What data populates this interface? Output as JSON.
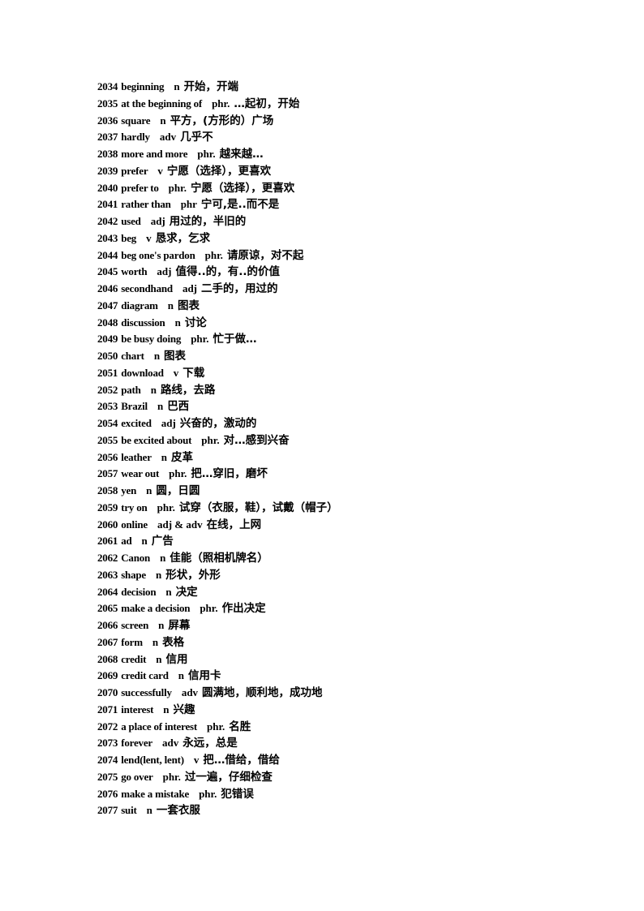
{
  "document": {
    "entries": [
      {
        "num": "2034",
        "word": "beginning",
        "pos": "n",
        "meaning": "开始，开端"
      },
      {
        "num": "2035",
        "word": "at the beginning of",
        "pos": "phr.",
        "meaning": "…起初，开始"
      },
      {
        "num": "2036",
        "word": "square",
        "pos": "n",
        "meaning": "平方，(方形的）广场"
      },
      {
        "num": "2037",
        "word": "hardly",
        "pos": "adv",
        "meaning": "几乎不"
      },
      {
        "num": "2038",
        "word": "more and more",
        "pos": "phr.",
        "meaning": "越来越…"
      },
      {
        "num": "2039",
        "word": "prefer",
        "pos": "v",
        "meaning": "宁愿（选择），更喜欢"
      },
      {
        "num": "2040",
        "word": "prefer to",
        "pos": "phr.",
        "meaning": "宁愿（选择），更喜欢"
      },
      {
        "num": "2041",
        "word": "rather than",
        "pos": "phr",
        "meaning": "宁可,是..而不是"
      },
      {
        "num": "2042",
        "word": "used",
        "pos": "adj",
        "meaning": "用过的，半旧的"
      },
      {
        "num": "2043",
        "word": "beg",
        "pos": "v",
        "meaning": "恳求，乞求"
      },
      {
        "num": "2044",
        "word": "beg one's pardon",
        "pos": "phr.",
        "meaning": "请原谅，对不起"
      },
      {
        "num": "2045",
        "word": "worth",
        "pos": "adj",
        "meaning": "值得..的，有..的价值"
      },
      {
        "num": "2046",
        "word": "secondhand",
        "pos": "adj",
        "meaning": "二手的，用过的"
      },
      {
        "num": "2047",
        "word": "diagram",
        "pos": "n",
        "meaning": "图表"
      },
      {
        "num": "2048",
        "word": "discussion",
        "pos": "n",
        "meaning": "讨论"
      },
      {
        "num": "2049",
        "word": "be busy doing",
        "pos": "phr.",
        "meaning": "忙于做…"
      },
      {
        "num": "2050",
        "word": "chart",
        "pos": "n",
        "meaning": "图表"
      },
      {
        "num": "2051",
        "word": "download",
        "pos": "v",
        "meaning": "下载"
      },
      {
        "num": "2052",
        "word": "path",
        "pos": "n",
        "meaning": "路线，去路"
      },
      {
        "num": "2053",
        "word": "Brazil",
        "pos": "n",
        "meaning": "巴西"
      },
      {
        "num": "2054",
        "word": "excited",
        "pos": "adj",
        "meaning": "兴奋的，激动的"
      },
      {
        "num": "2055",
        "word": "be excited about",
        "pos": "phr.",
        "meaning": "对…感到兴奋"
      },
      {
        "num": "2056",
        "word": "leather",
        "pos": "n",
        "meaning": "皮革"
      },
      {
        "num": "2057",
        "word": "wear out",
        "pos": "phr.",
        "meaning": "把…穿旧，磨坏"
      },
      {
        "num": "2058",
        "word": "yen",
        "pos": "n",
        "meaning": "圆，日圆"
      },
      {
        "num": "2059",
        "word": "try on",
        "pos": "phr.",
        "meaning": "试穿（衣服，鞋），试戴（帽子）"
      },
      {
        "num": "2060",
        "word": "online",
        "pos": "adj & adv",
        "meaning": "在线，上网"
      },
      {
        "num": "2061",
        "word": "ad",
        "pos": "n",
        "meaning": "广告"
      },
      {
        "num": "2062",
        "word": "Canon",
        "pos": "n",
        "meaning": "佳能（照相机牌名）"
      },
      {
        "num": "2063",
        "word": "shape",
        "pos": "n",
        "meaning": "形状，外形"
      },
      {
        "num": "2064",
        "word": "decision",
        "pos": "n",
        "meaning": "决定"
      },
      {
        "num": "2065",
        "word": "make a decision",
        "pos": "phr.",
        "meaning": "作出决定"
      },
      {
        "num": "2066",
        "word": "screen",
        "pos": "n",
        "meaning": "屏幕"
      },
      {
        "num": "2067",
        "word": "form",
        "pos": "n",
        "meaning": "表格"
      },
      {
        "num": "2068",
        "word": "credit",
        "pos": "n",
        "meaning": "信用"
      },
      {
        "num": "2069",
        "word": "credit card",
        "pos": "n",
        "meaning": "信用卡"
      },
      {
        "num": "2070",
        "word": "successfully",
        "pos": "adv",
        "meaning": "圆满地，顺利地，成功地"
      },
      {
        "num": "2071",
        "word": "interest",
        "pos": "n",
        "meaning": "兴趣"
      },
      {
        "num": "2072",
        "word": "a place of interest",
        "pos": "phr.",
        "meaning": "名胜"
      },
      {
        "num": "2073",
        "word": "forever",
        "pos": "adv",
        "meaning": "永远，总是"
      },
      {
        "num": "2074",
        "word": "lend(lent, lent)",
        "pos": "v",
        "meaning": "把…借给，借给"
      },
      {
        "num": "2075",
        "word": "go over",
        "pos": "phr.",
        "meaning": "过一遍，仔细检查"
      },
      {
        "num": "2076",
        "word": "make a mistake",
        "pos": "phr.",
        "meaning": "犯错误"
      },
      {
        "num": "2077",
        "word": "suit",
        "pos": "n",
        "meaning": "一套衣服"
      }
    ]
  }
}
